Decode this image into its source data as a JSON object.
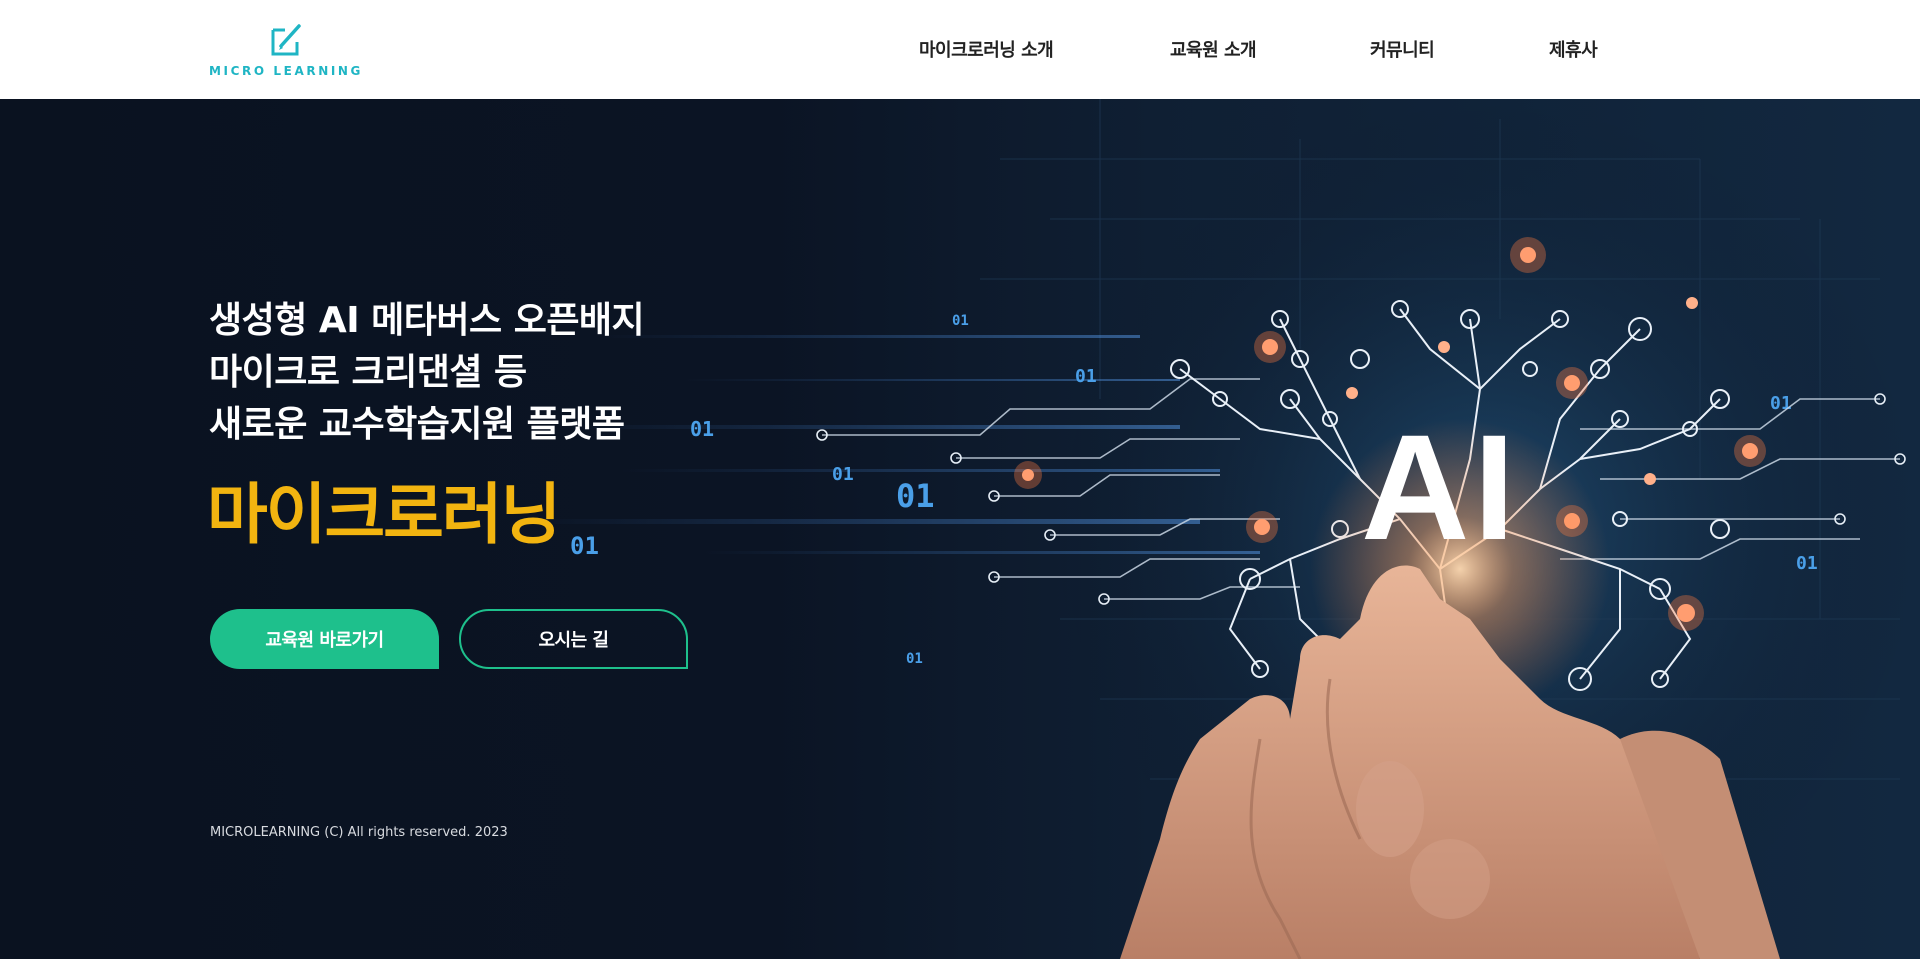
{
  "header": {
    "logo_text": "MICRO LEARNING",
    "nav": [
      {
        "label": "마이크로러닝 소개"
      },
      {
        "label": "교육원 소개"
      },
      {
        "label": "커뮤니티"
      },
      {
        "label": "제휴사"
      }
    ]
  },
  "hero": {
    "headline": [
      "생성형 AI 메타버스 오픈배지",
      "마이크로 크리댄셜 등",
      "새로운 교수학습지원 플랫폼"
    ],
    "brand_title": "마이크로러닝",
    "primary_button": "교육원 바로가기",
    "secondary_button": "오시는 길",
    "art_text": "AI",
    "binary_labels": [
      "01",
      "01",
      "01",
      "01",
      "01",
      "01",
      "01",
      "01",
      "01"
    ]
  },
  "footer": {
    "copyright": "MICROLEARNING (C) All rights reserved. 2023"
  },
  "colors": {
    "accent_teal": "#1fb5c4",
    "button_green": "#1ec08c",
    "brand_yellow": "#f2b410",
    "hero_bg": "#0b1322"
  },
  "icons": {
    "logo": "pencil-book-icon"
  }
}
